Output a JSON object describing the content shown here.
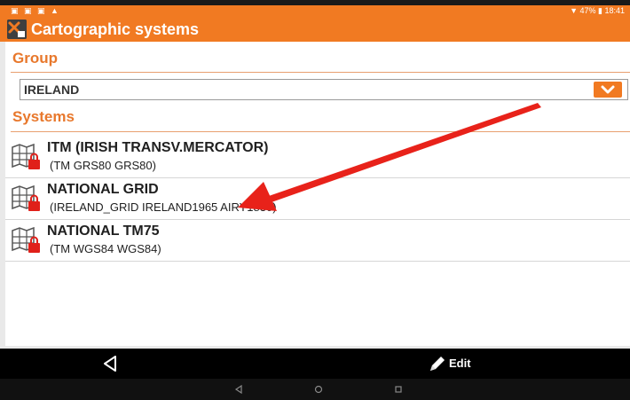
{
  "statusbar": {
    "left_icons": "▣ ▣ ▣ ▲",
    "right_text": "▼ 47% ▮ 18:41"
  },
  "header": {
    "title": "Cartographic systems",
    "icon": "cartographic-app-icon"
  },
  "group": {
    "section_title": "Group",
    "selected": "IRELAND",
    "dropdown_icon": "chevron-down-icon"
  },
  "systems": {
    "section_title": "Systems",
    "items": [
      {
        "name": "ITM (IRISH TRANSV.MERCATOR)",
        "detail": "(TM GRS80 GRS80)",
        "icon": "map-lock-icon"
      },
      {
        "name": "NATIONAL GRID",
        "detail": "(IRELAND_GRID IRELAND1965 AIRY1830)",
        "icon": "map-lock-icon"
      },
      {
        "name": "NATIONAL TM75",
        "detail": "(TM WGS84 WGS84)",
        "icon": "map-lock-icon"
      }
    ]
  },
  "annotation": {
    "icon": "red-arrow-annotation",
    "color": "#e8221a"
  },
  "toolbar": {
    "edit_label": "Edit",
    "back_icon": "back-triangle-icon",
    "edit_icon": "pencil-icon"
  },
  "navbar": {
    "back_icon": "nav-back-icon",
    "home_icon": "nav-home-icon",
    "recents_icon": "nav-recents-icon"
  },
  "colors": {
    "accent": "#f17a22",
    "section_text": "#e8782c",
    "lock_red": "#e0201a"
  }
}
